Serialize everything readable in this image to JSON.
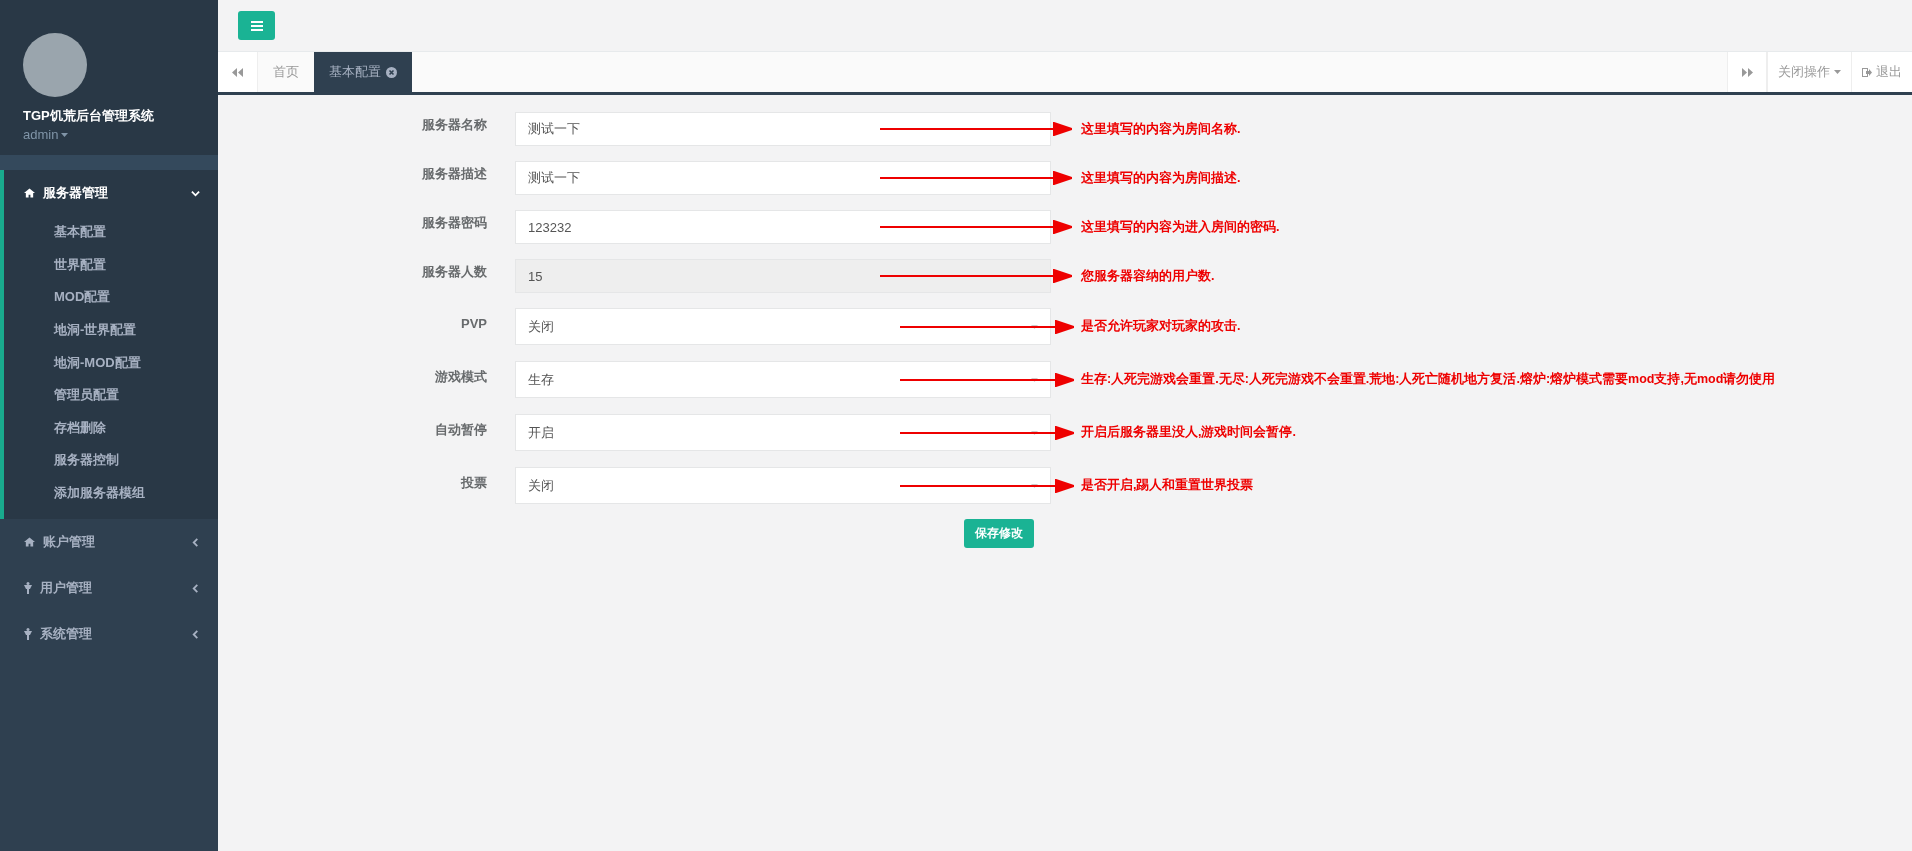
{
  "sidebar": {
    "profile": {
      "title": "TGP饥荒后台管理系统",
      "user": "admin"
    },
    "menu": [
      {
        "label": "服务器管理",
        "expanded": true,
        "children": [
          {
            "label": "基本配置"
          },
          {
            "label": "世界配置"
          },
          {
            "label": "MOD配置"
          },
          {
            "label": "地洞-世界配置"
          },
          {
            "label": "地洞-MOD配置"
          },
          {
            "label": "管理员配置"
          },
          {
            "label": "存档删除"
          },
          {
            "label": "服务器控制"
          },
          {
            "label": "添加服务器模组"
          }
        ]
      },
      {
        "label": "账户管理",
        "expanded": false
      },
      {
        "label": "用户管理",
        "expanded": false
      },
      {
        "label": "系统管理",
        "expanded": false
      }
    ]
  },
  "tabs": [
    {
      "label": "首页",
      "selected": false
    },
    {
      "label": "基本配置",
      "selected": true
    }
  ],
  "toolbar": {
    "close_menu": "关闭操作",
    "logout": "退出"
  },
  "form": {
    "rows": [
      {
        "label": "服务器名称",
        "kind": "input",
        "value": "测试一下",
        "disabled": false,
        "note": "这里填写的内容为房间名称."
      },
      {
        "label": "服务器描述",
        "kind": "input",
        "value": "测试一下",
        "disabled": false,
        "note": "这里填写的内容为房间描述."
      },
      {
        "label": "服务器密码",
        "kind": "input",
        "value": "123232",
        "disabled": false,
        "note": "这里填写的内容为进入房间的密码."
      },
      {
        "label": "服务器人数",
        "kind": "input",
        "value": "15",
        "disabled": true,
        "note": "您服务器容纳的用户数."
      },
      {
        "label": "PVP",
        "kind": "select",
        "value": "关闭",
        "note": "是否允许玩家对玩家的攻击."
      },
      {
        "label": "游戏模式",
        "kind": "select",
        "value": "生存",
        "note": "生存:人死完游戏会重置.无尽:人死完游戏不会重置.荒地:人死亡随机地方复活.熔炉:熔炉模式需要mod支持,无mod请勿使用"
      },
      {
        "label": "自动暂停",
        "kind": "select",
        "value": "开启",
        "note": "开启后服务器里没人,游戏时间会暂停."
      },
      {
        "label": "投票",
        "kind": "select",
        "value": "关闭",
        "note": "是否开启,踢人和重置世界投票"
      }
    ],
    "submit": "保存修改"
  }
}
